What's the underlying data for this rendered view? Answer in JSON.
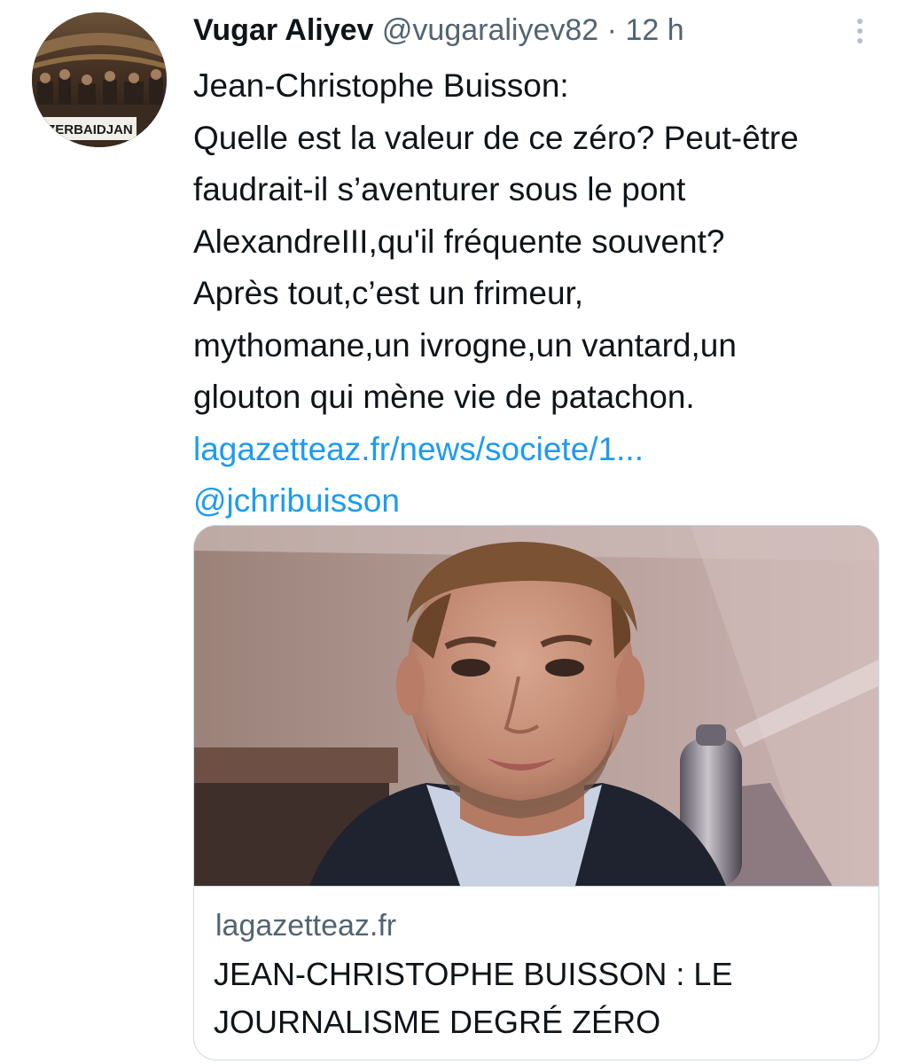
{
  "tweet": {
    "author": {
      "display_name": "Vugar Aliyev",
      "handle": "@vugaraliyev82",
      "avatar_caption": "AZERBAIDJAN"
    },
    "separator": "·",
    "timestamp": "12 h",
    "more_icon": "more-vertical-icon",
    "text_lines": [
      "Jean-Christophe Buisson:",
      "Quelle est la valeur de ce zéro? Peut-être",
      "faudrait-il s’aventurer sous le pont",
      "AlexandreIII,qu'il fréquente souvent?",
      "Après tout,c’est un frimeur,",
      "mythomane,un ivrogne,un vantard,un",
      "glouton qui mène vie de patachon."
    ],
    "link_text": "lagazetteaz.fr/news/societe/1...",
    "mention": "@jchribuisson",
    "card": {
      "domain": "lagazetteaz.fr",
      "title_lines": [
        "JEAN-CHRISTOPHE BUISSON : LE",
        "JOURNALISME DEGRÉ ZÉRO"
      ]
    }
  },
  "colors": {
    "text_primary": "#0f1419",
    "text_secondary": "#536471",
    "link": "#1d9bf0",
    "border": "#cfd9de"
  }
}
